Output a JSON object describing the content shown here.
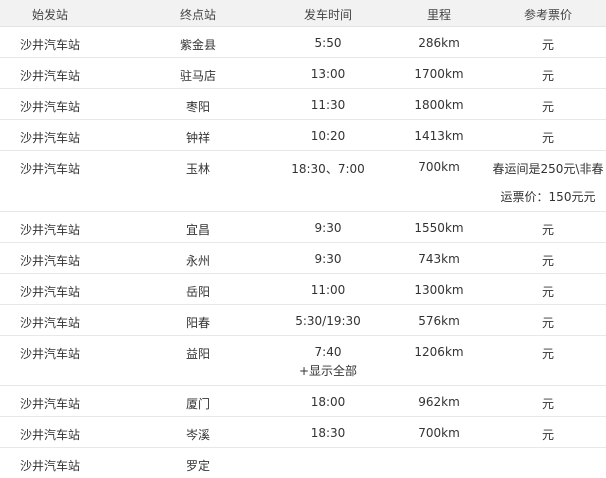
{
  "headers": {
    "origin": "始发站",
    "destination": "终点站",
    "departure": "发车时间",
    "distance": "里程",
    "price": "参考票价"
  },
  "rows": [
    {
      "origin": "沙井汽车站",
      "destination": "紫金县",
      "time": "5:50",
      "distance": "286km",
      "price": "元"
    },
    {
      "origin": "沙井汽车站",
      "destination": "驻马店",
      "time": "13:00",
      "distance": "1700km",
      "price": "元"
    },
    {
      "origin": "沙井汽车站",
      "destination": "枣阳",
      "time": "11:30",
      "distance": "1800km",
      "price": "元"
    },
    {
      "origin": "沙井汽车站",
      "destination": "钟祥",
      "time": "10:20",
      "distance": "1413km",
      "price": "元"
    },
    {
      "origin": "沙井汽车站",
      "destination": "玉林",
      "time": "18:30、7:00",
      "distance": "700km",
      "price": "春运间是250元\\非春",
      "price_line2": "运票价：150元元"
    },
    {
      "origin": "沙井汽车站",
      "destination": "宜昌",
      "time": "9:30",
      "distance": "1550km",
      "price": "元"
    },
    {
      "origin": "沙井汽车站",
      "destination": "永州",
      "time": "9:30",
      "distance": "743km",
      "price": "元"
    },
    {
      "origin": "沙井汽车站",
      "destination": "岳阳",
      "time": "11:00",
      "distance": "1300km",
      "price": "元"
    },
    {
      "origin": "沙井汽车站",
      "destination": "阳春",
      "time": "5:30/19:30",
      "distance": "576km",
      "price": "元"
    },
    {
      "origin": "沙井汽车站",
      "destination": "益阳",
      "time": "7:40",
      "distance": "1206km",
      "price": "元"
    },
    {
      "origin": "沙井汽车站",
      "destination": "厦门",
      "time": "18:00",
      "distance": "962km",
      "price": "元"
    },
    {
      "origin": "沙井汽车站",
      "destination": "岑溪",
      "time": "18:30",
      "distance": "700km",
      "price": "元"
    },
    {
      "origin": "沙井汽车站",
      "destination": "罗定",
      "time": "",
      "distance": "",
      "price": ""
    }
  ],
  "show_all_label": "+显示全部"
}
